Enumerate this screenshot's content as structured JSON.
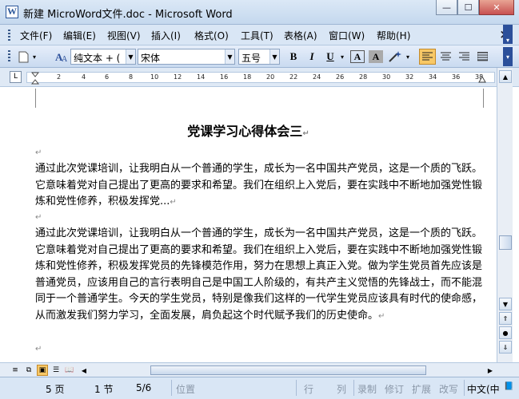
{
  "window": {
    "title": "新建 MicroWord文件.doc - Microsoft Word",
    "app_icon_letter": "W",
    "minimize_glyph": "—",
    "maximize_glyph": "☐",
    "close_glyph": "✕"
  },
  "menu": {
    "items": [
      "文件(F)",
      "编辑(E)",
      "视图(V)",
      "插入(I)",
      "格式(O)",
      "工具(T)",
      "表格(A)",
      "窗口(W)",
      "帮助(H)"
    ],
    "close_glyph": "×"
  },
  "toolbar": {
    "style_value": "纯文本 + (",
    "font_value": "宋体",
    "size_value": "五号",
    "bold": "B",
    "italic": "I",
    "underline": "U",
    "char_border": "A",
    "char_shading": "A"
  },
  "ruler": {
    "numbers": [
      "2",
      "4",
      "6",
      "8",
      "10",
      "12",
      "14",
      "16",
      "18",
      "20",
      "22",
      "24",
      "26",
      "28",
      "30",
      "32",
      "34",
      "36",
      "38"
    ],
    "tab_glyph": "L"
  },
  "document": {
    "title": "党课学习心得体会三",
    "para_mark": "↵",
    "para1": "通过此次党课培训，让我明白从一个普通的学生，成长为一名中国共产党员，这是一个质的飞跃。它意味着党对自己提出了更高的要求和希望。我们在组织上入党后，要在实践中不断地加强党性锻炼和党性修养，积极发挥党...",
    "para2": "通过此次党课培训，让我明白从一个普通的学生，成长为一名中国共产党员，这是一个质的飞跃。它意味着党对自己提出了更高的要求和希望。我们在组织上入党后，要在实践中不断地加强党性锻炼和党性修养，积极发挥党员的先锋模范作用，努力在思想上真正入党。做为学生党员首先应该是普通党员，应该用自己的言行表明自己是中国工人阶级的，有共产主义觉悟的先锋战士，而不能混同于一个普通学生。今天的学生党员，特别是像我们这样的一代学生党员应该具有时代的使命感，从而激发我们努力学习，全面发展，肩负起这个时代赋予我们的历史使命。"
  },
  "status": {
    "page": "5 页",
    "section": "1 节",
    "page_of": "5/6",
    "position": "位置",
    "line": "行",
    "column": "列",
    "record": "录制",
    "revise": "修订",
    "extend": "扩展",
    "overwrite": "改写",
    "language": "中文(中"
  },
  "scroll": {
    "up": "▲",
    "down": "▼",
    "prev_page": "⇑",
    "select_browse": "●",
    "next_page": "⇓"
  }
}
